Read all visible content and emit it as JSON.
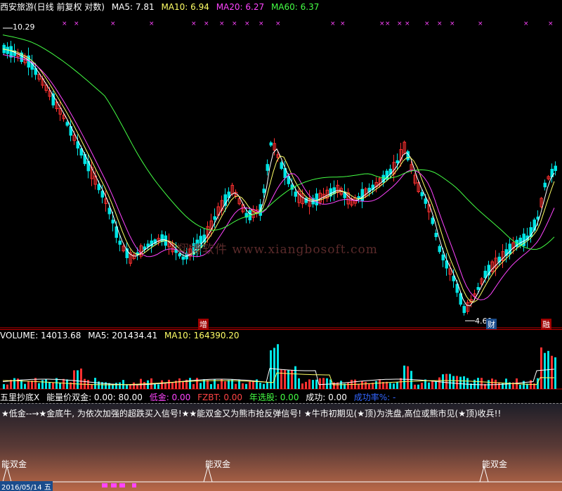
{
  "header": {
    "stock_name": "西安旅游(日线 前复权 对数)",
    "ma5": "MA5: 7.81",
    "ma10": "MA10: 6.94",
    "ma20": "MA20: 6.27",
    "ma60": "MA60: 6.37",
    "colors": {
      "ma5": "#ffffff",
      "ma10": "#ffff66",
      "ma20": "#ff44ff",
      "ma60": "#44ff44"
    }
  },
  "price": {
    "high_label": "10.29",
    "low_label": "4.60",
    "tag_zeng": "增",
    "tag_cai": "财",
    "tag_rong": "融"
  },
  "watermark": "翔博软件 www.xiangbosoft.com",
  "volume": {
    "vol": "VOLUME: 14013.68",
    "ma5": "MA5: 201434.41",
    "ma10": "MA10: 164390.20"
  },
  "indicator": {
    "name": "五里抄底X",
    "f1": "能量价双金: 0.00",
    "f1b": ": 80.00",
    "f2": "低金: 0.00",
    "f3": "FZBT: 0.00",
    "f4": "年选股: 0.00",
    "f5": "成功: 0.00",
    "f6": "成功率%: -"
  },
  "signal": {
    "text": "★低金--→★金底牛, 为依次加强的超跌买入信号!★★能双金又为熊市抢反弹信号! ★牛市初期见(★顶)为洗盘,高位或熊市见(★顶)收兵!!",
    "markers": [
      "能双金",
      "能双金",
      "能双金"
    ],
    "date_stub": "2016/05/14 五"
  }
}
